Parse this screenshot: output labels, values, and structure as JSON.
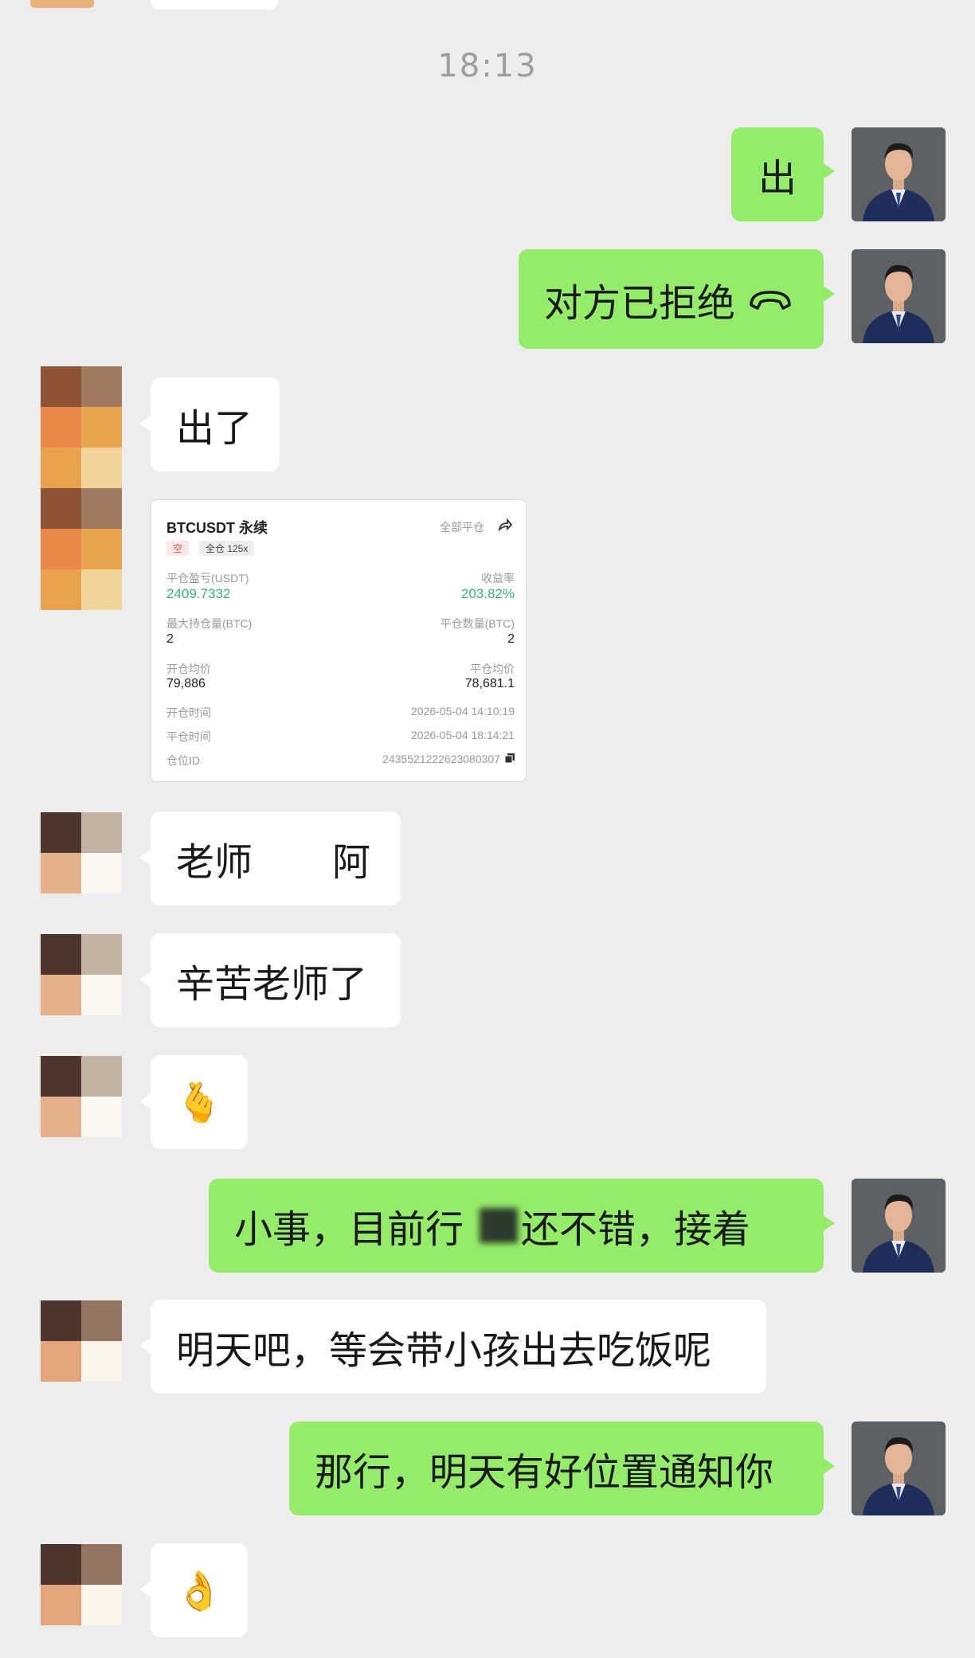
{
  "timestamp": "18:13",
  "messages": {
    "m1": "出",
    "m2": "对方已拒绝",
    "m3": "出了",
    "m4": "老师",
    "m4b": "阿",
    "m5": "辛苦老师了",
    "m6": "🫰",
    "m7": "小事，目前行",
    "m7b": "还不错，接着",
    "m8": "明天吧，等会带小孩出去吃饭呢",
    "m9": "那行，明天有好位置通知你",
    "m10": "👌"
  },
  "trade_card": {
    "symbol": "BTCUSDT 永续",
    "close_all": "全部平仓",
    "side": "空",
    "leverage": "全仓 125x",
    "pnl_label": "平仓盈亏(USDT)",
    "pnl": "2409.7332",
    "roi_label": "收益率",
    "roi": "203.82%",
    "max_pos_label": "最大持仓量(BTC)",
    "max_pos": "2",
    "close_qty_label": "平仓数量(BTC)",
    "close_qty": "2",
    "open_avg_label": "开仓均价",
    "open_avg": "79,886",
    "close_avg_label": "平仓均价",
    "close_avg": "78,681.1",
    "open_time_label": "开仓时间",
    "open_time": "2026-05-04 14:10:19",
    "close_time_label": "平仓时间",
    "close_time": "2026-05-04 18:14:21",
    "pos_id_label": "仓位ID",
    "pos_id": "2435521222623080307"
  },
  "colors": {
    "bg": "#ededed",
    "my_bubble": "#95ec69",
    "their_bubble": "#ffffff",
    "profit": "#3ab37a"
  }
}
